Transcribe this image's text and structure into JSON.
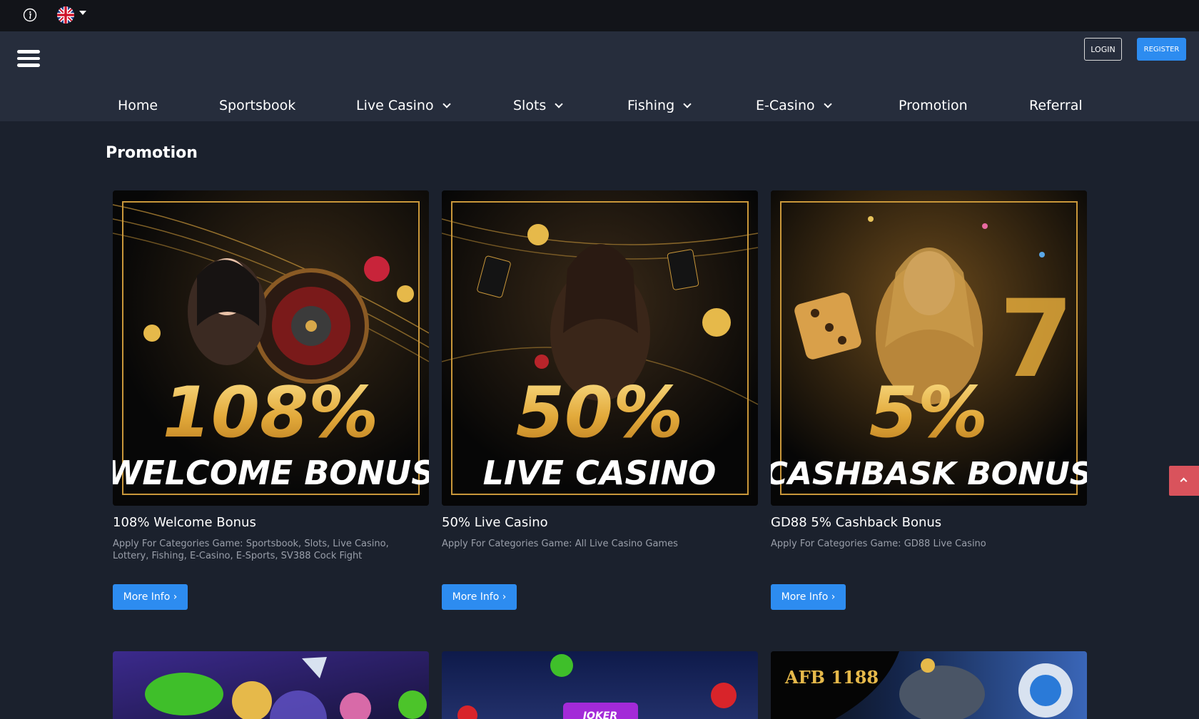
{
  "topbar": {
    "info_icon": "info-icon",
    "language_flag": "uk-flag-icon"
  },
  "header": {
    "menu_icon": "hamburger-menu-icon",
    "login_label": "LOGIN",
    "register_label": "REGISTER"
  },
  "nav": {
    "items": [
      {
        "label": "Home",
        "dropdown": false
      },
      {
        "label": "Sportsbook",
        "dropdown": false
      },
      {
        "label": "Live Casino",
        "dropdown": true
      },
      {
        "label": "Slots",
        "dropdown": true
      },
      {
        "label": "Fishing",
        "dropdown": true
      },
      {
        "label": "E-Casino",
        "dropdown": true
      },
      {
        "label": "Promotion",
        "dropdown": false
      },
      {
        "label": "Referral",
        "dropdown": false
      }
    ]
  },
  "page": {
    "title": "Promotion"
  },
  "promotions": [
    {
      "banner_big": "108%",
      "banner_small": "WELCOME BONUS",
      "title_prefix": "108%",
      "title_main": "Welcome Bonus",
      "description": "Apply For Categories Game: Sportsbook, Slots, Live Casino, Lottery, Fishing, E-Casino, E-Sports, SV388 Cock Fight",
      "button": "More Info ›"
    },
    {
      "banner_big": "50%",
      "banner_small": "LIVE CASINO",
      "title_prefix": "50%",
      "title_main": "Live Casino",
      "description": "Apply For Categories Game: All Live Casino Games",
      "button": "More Info ›"
    },
    {
      "banner_big": "5%",
      "banner_small": "CASHBASK BONUS",
      "title_prefix": "GD88 5%",
      "title_main": "Cashback Bonus",
      "description": "Apply For Categories Game: GD88 Live Casino",
      "button": "More Info ›"
    }
  ],
  "next_row": {
    "thumb2_label": "JOKER",
    "thumb3_label": "AFB 1188"
  },
  "colors": {
    "accent": "#2d8cf0",
    "gold": "#e8b54a",
    "back_to_top": "#d9535c"
  },
  "back_to_top_icon": "chevron-up-icon"
}
